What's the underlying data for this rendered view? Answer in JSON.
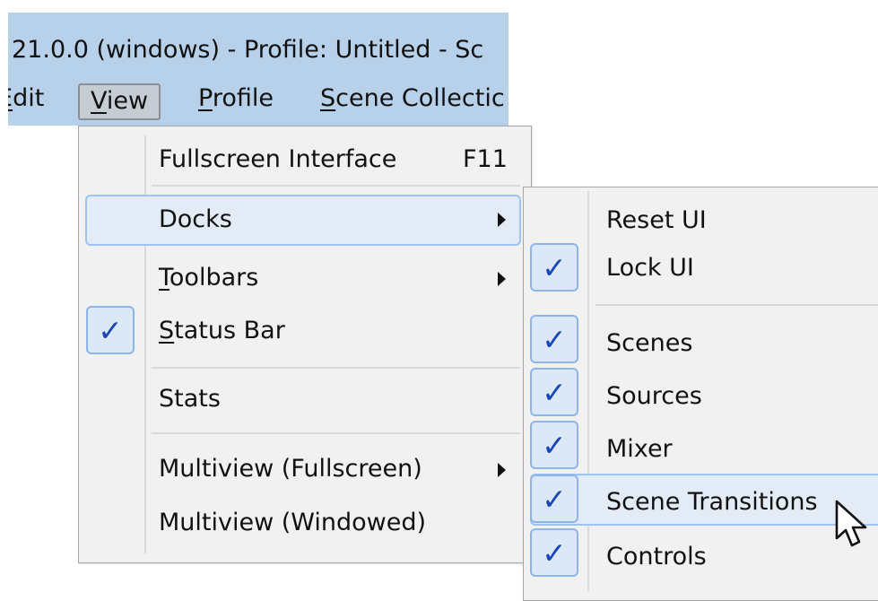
{
  "window": {
    "title": "21.0.0 (windows) - Profile: Untitled - Sc"
  },
  "menubar": {
    "items": [
      {
        "label": "Edit",
        "mnemonic_index": 0
      },
      {
        "label": "View",
        "mnemonic_index": 0,
        "active": true
      },
      {
        "label": "Profile",
        "mnemonic_index": 0
      },
      {
        "label": "Scene Collectic",
        "mnemonic_index": 0
      }
    ]
  },
  "view_menu": {
    "items": [
      {
        "label": "Fullscreen Interface",
        "shortcut": "F11"
      },
      {
        "label": "Docks",
        "submenu": true,
        "highlighted": true
      },
      {
        "label": "Toolbars",
        "submenu": true
      },
      {
        "label": "Status Bar",
        "checked": true
      },
      {
        "label": "Stats"
      },
      {
        "label": "Multiview (Fullscreen)",
        "submenu": true
      },
      {
        "label": "Multiview (Windowed)"
      }
    ]
  },
  "docks_menu": {
    "items": [
      {
        "label": "Reset UI"
      },
      {
        "label": "Lock UI",
        "checked": true
      },
      {
        "label": "Scenes",
        "checked": true
      },
      {
        "label": "Sources",
        "checked": true
      },
      {
        "label": "Mixer",
        "checked": true
      },
      {
        "label": "Scene Transitions",
        "checked": true,
        "highlighted": true
      },
      {
        "label": "Controls",
        "checked": true
      }
    ]
  },
  "check_glyph": "✓",
  "colors": {
    "menubar_bg": "#b8d1ea",
    "menu_bg": "#f1f1f1",
    "highlight_bg": "#e3ebf6",
    "highlight_border": "#9fc3ef",
    "check_color": "#1a47b8"
  }
}
